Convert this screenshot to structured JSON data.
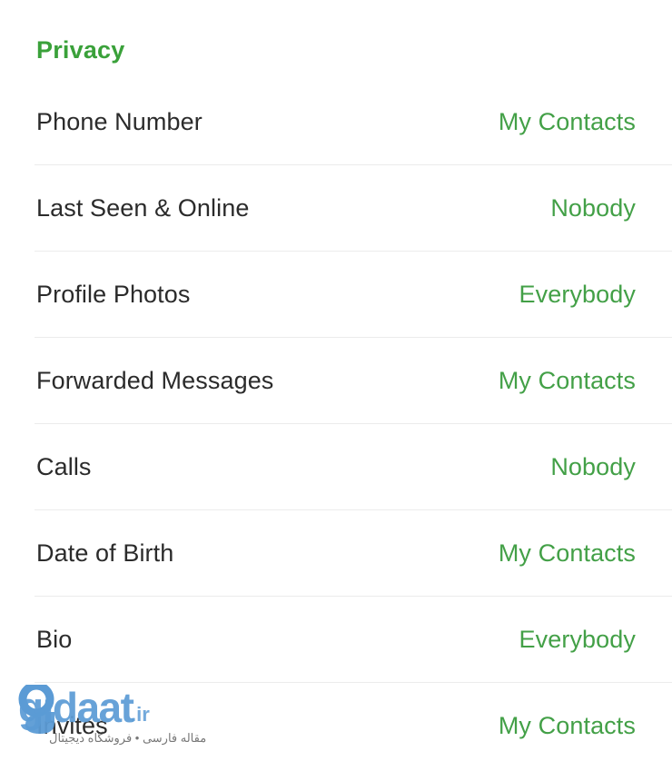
{
  "section": {
    "title": "Privacy",
    "accent_color": "#3aa13a"
  },
  "theme": {
    "background": "#ffffff",
    "label_color": "#2b2b2b",
    "value_color": "#43a047",
    "divider_color": "#ececec",
    "watermark_color": "#5b9bd5"
  },
  "rows": [
    {
      "label": "Phone Number",
      "value": "My Contacts"
    },
    {
      "label": "Last Seen & Online",
      "value": "Nobody"
    },
    {
      "label": "Profile Photos",
      "value": "Everybody"
    },
    {
      "label": "Forwarded Messages",
      "value": "My Contacts"
    },
    {
      "label": "Calls",
      "value": "Nobody"
    },
    {
      "label": "Date of Birth",
      "value": "My Contacts"
    },
    {
      "label": "Bio",
      "value": "Everybody"
    },
    {
      "label": "Invites",
      "value": "My Contacts"
    }
  ],
  "watermark": {
    "brand": "gidaat",
    "tld": ".ir",
    "subtitle": "مقاله فارسی • فروشگاه دیجیتال"
  }
}
